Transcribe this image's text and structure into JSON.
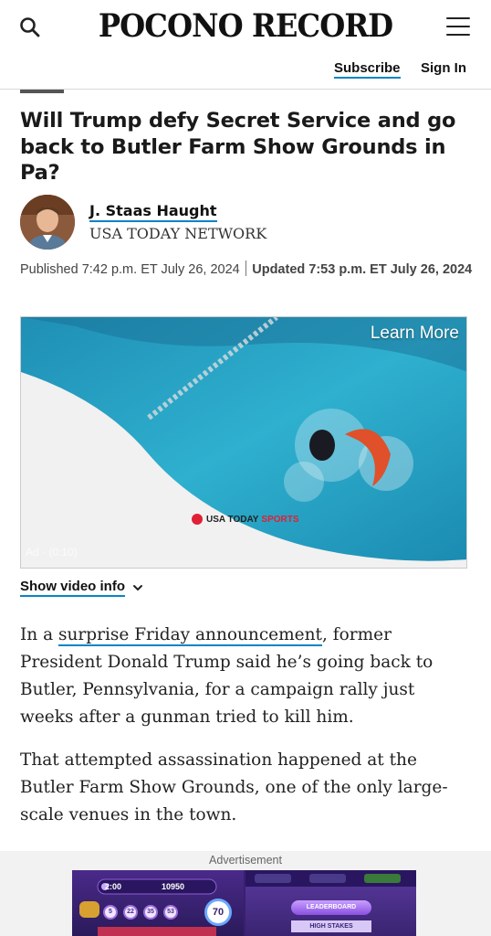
{
  "header": {
    "logo": "POCONO RECORD",
    "subscribe": "Subscribe",
    "sign_in": "Sign In"
  },
  "article": {
    "headline": "Will Trump defy Secret Service and go back to Butler Farm Show Grounds in Pa?",
    "author": "J. Staas Haught",
    "org": "USA TODAY NETWORK",
    "published": "Published 7:42 p.m. ET July 26, 2024",
    "updated": "Updated 7:53 p.m. ET July 26, 2024",
    "p1_before": "In a ",
    "p1_link": "surprise Friday announcement",
    "p1_after": ", former President Donald Trump said he’s going back to Butler, Pennsylvania, for a campaign rally just weeks after a gunman tried to kill him.",
    "p2": "That attempted assassination happened at the Butler Farm Show Grounds, one of the only large-scale venues in the town."
  },
  "video": {
    "learn_more": "Learn More",
    "brand": "USA TODAY",
    "brand_accent": "SPORTS",
    "ad_timer": "Ad · (0:10)",
    "show_info": "Show video info"
  },
  "ad": {
    "label": "Advertisement",
    "time": "2:00",
    "score": "10950",
    "balls": [
      "5",
      "22",
      "35",
      "53"
    ],
    "current_ball": "70",
    "leaderboard": "LEADERBOARD",
    "high_stakes": "HIGH STAKES"
  },
  "colors": {
    "link_underline": "#0a84c4",
    "pool": "#27a9c9",
    "brand_red": "#e02034"
  }
}
